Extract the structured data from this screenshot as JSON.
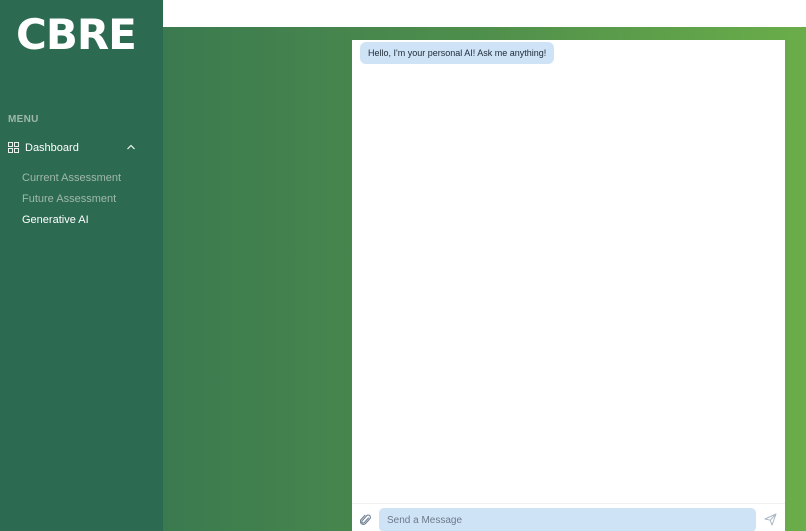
{
  "sidebar": {
    "logo_text": "CBRE",
    "menu_heading": "MENU",
    "dashboard": {
      "label": "Dashboard",
      "icon": "grid-icon",
      "expanded": true
    },
    "sub_items": [
      {
        "label": "Current Assessment",
        "active": false
      },
      {
        "label": "Future Assessment",
        "active": false
      },
      {
        "label": "Generative AI",
        "active": true
      }
    ]
  },
  "chat": {
    "greeting": "Hello, I'm your personal AI! Ask me anything!",
    "input_placeholder": "Send a Message",
    "input_value": "",
    "attach_icon": "paperclip-icon",
    "send_icon": "send-icon"
  },
  "colors": {
    "sidebar_bg": "#2d6a52",
    "gradient_start": "#3b7a4f",
    "gradient_end": "#6aad49",
    "bubble_bg": "#cfe3f7"
  }
}
